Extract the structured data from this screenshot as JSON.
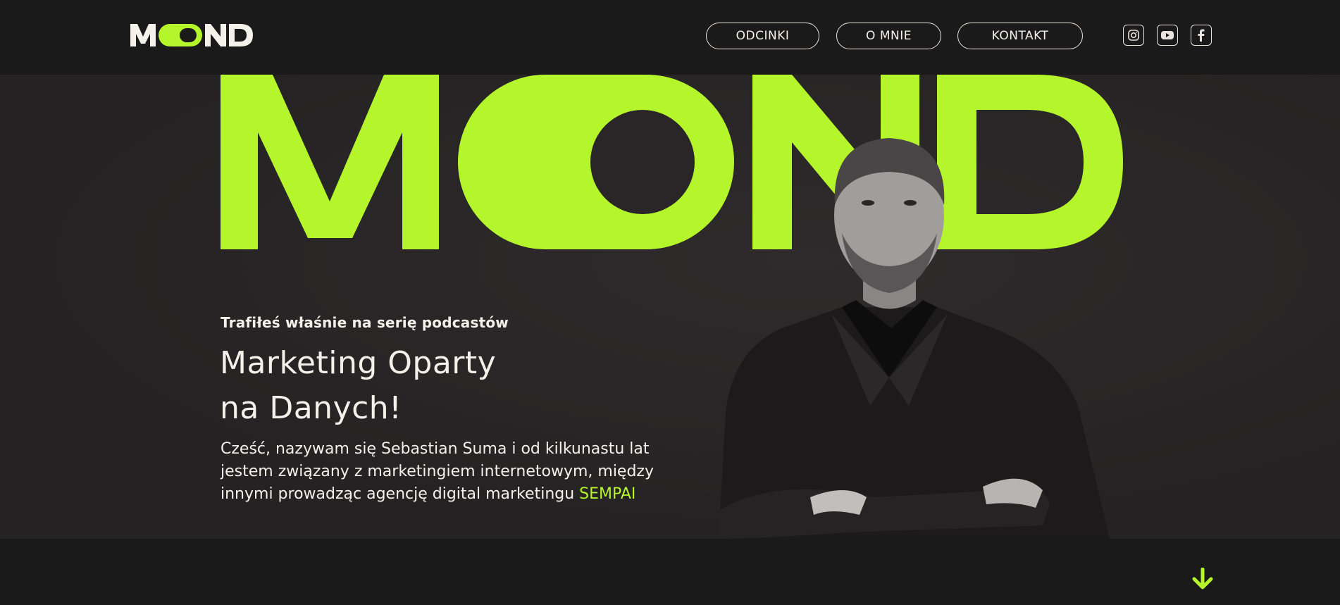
{
  "brand": {
    "logo_text": "MOND",
    "accent_color": "#b4f52b",
    "background_color": "#1b1a1b"
  },
  "nav": {
    "items": [
      {
        "label": "ODCINKI"
      },
      {
        "label": "O MNIE"
      },
      {
        "label": "KONTAKT"
      }
    ]
  },
  "social": {
    "items": [
      {
        "icon": "instagram-icon"
      },
      {
        "icon": "youtube-icon"
      },
      {
        "icon": "facebook-icon"
      }
    ]
  },
  "hero": {
    "kicker": "Trafiłeś właśnie na serię podcastów",
    "headline_line1": "Marketing Oparty",
    "headline_line2": "na Danych!",
    "bio_text": "Cześć, nazywam się Sebastian Suma i od kilkunastu lat jestem związany z marketingiem internetowym, między innymi prowadząc agencję digital marketingu ",
    "bio_link": "SEMPAI",
    "portrait_icon": "portrait-photo"
  },
  "scroll": {
    "icon": "arrow-down-icon"
  }
}
